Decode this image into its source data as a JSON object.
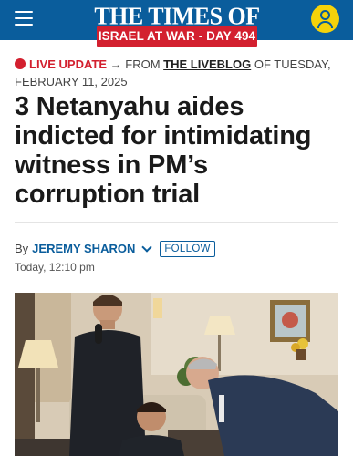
{
  "header": {
    "logo_text": "THE TIMES OF ISRAEL",
    "war_badge": "ISRAEL AT WAR - DAY 494",
    "menu_icon": "hamburger-menu-icon",
    "user_icon": "user-account-icon"
  },
  "live_update": {
    "label": "LIVE UPDATE",
    "arrow": "→",
    "from_text": "FROM",
    "liveblog_link": "THE LIVEBLOG",
    "date_text": "OF TUESDAY, FEBRUARY 11, 2025"
  },
  "article": {
    "headline": "3 Netanyahu aides indicted for intimidating witness in PM’s corruption trial",
    "by_prefix": "By",
    "author": "JEREMY SHARON",
    "follow_label": "FOLLOW",
    "timestamp": "Today, 12:10 pm"
  },
  "colors": {
    "brand_blue": "#0a5d9c",
    "alert_red": "#d3202f",
    "account_yellow": "#f5d20a"
  }
}
